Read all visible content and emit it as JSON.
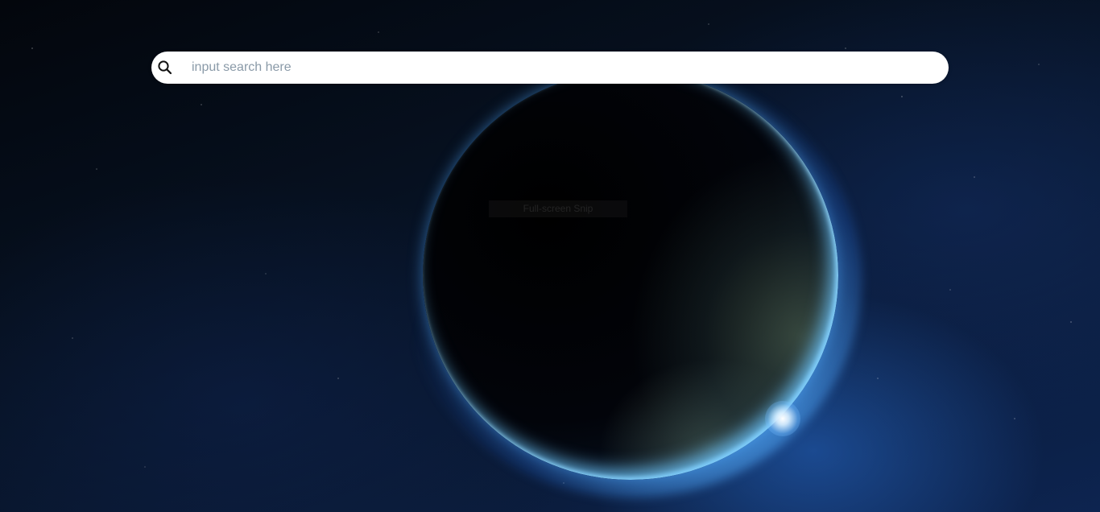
{
  "search": {
    "placeholder": "input search here",
    "value": "",
    "icon": "search-icon"
  },
  "overlay": {
    "label": "Full-screen Snip"
  },
  "colors": {
    "search_bg": "#ffffff",
    "placeholder": "#8a9aa8",
    "space_dark": "#040913",
    "atmosphere": "#6ec8ff"
  }
}
